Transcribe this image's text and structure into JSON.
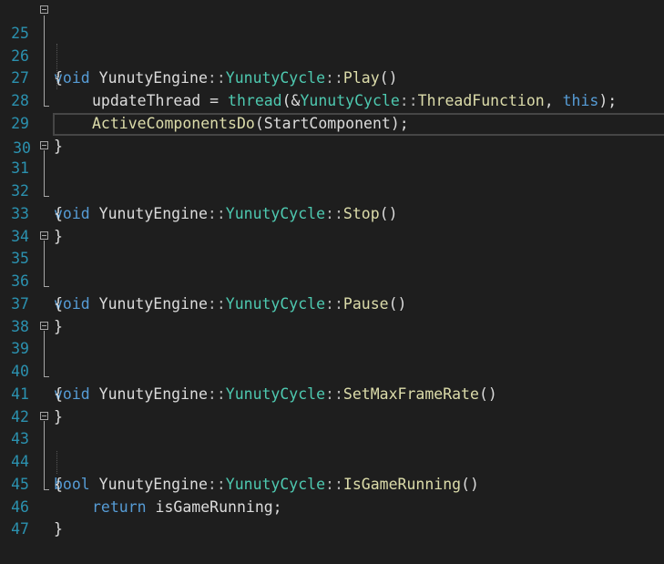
{
  "colors": {
    "background": "#1e1e1e",
    "line_number": "#2b91af",
    "keyword": "#569cd6",
    "type": "#4ec9b0",
    "function": "#dcdcaa",
    "plain": "#dcdcdc",
    "current_line_border": "#464646"
  },
  "lines": [
    {
      "num": "25",
      "tokens": [
        "void",
        " YunutyEngine",
        "::",
        "YunutyCycle",
        "::",
        "Play",
        "()"
      ]
    },
    {
      "num": "26",
      "tokens": [
        "{"
      ]
    },
    {
      "num": "27",
      "tokens": [
        "updateThread = ",
        "thread",
        "(&",
        "YunutyCycle",
        "::",
        "ThreadFunction",
        ", ",
        "this",
        ");"
      ]
    },
    {
      "num": "28",
      "tokens": [
        "ActiveComponentsDo",
        "(StartComponent);"
      ]
    },
    {
      "num": "29",
      "tokens": [
        "}"
      ]
    },
    {
      "num": "30",
      "tokens": []
    },
    {
      "num": "31",
      "tokens": [
        "void",
        " YunutyEngine",
        "::",
        "YunutyCycle",
        "::",
        "Stop",
        "()"
      ]
    },
    {
      "num": "32",
      "tokens": [
        "{"
      ]
    },
    {
      "num": "33",
      "tokens": [
        "}"
      ]
    },
    {
      "num": "34",
      "tokens": []
    },
    {
      "num": "35",
      "tokens": [
        "void",
        " YunutyEngine",
        "::",
        "YunutyCycle",
        "::",
        "Pause",
        "()"
      ]
    },
    {
      "num": "36",
      "tokens": [
        "{"
      ]
    },
    {
      "num": "37",
      "tokens": [
        "}"
      ]
    },
    {
      "num": "38",
      "tokens": []
    },
    {
      "num": "39",
      "tokens": [
        "void",
        " YunutyEngine",
        "::",
        "YunutyCycle",
        "::",
        "SetMaxFrameRate",
        "()"
      ]
    },
    {
      "num": "40",
      "tokens": [
        "{"
      ]
    },
    {
      "num": "41",
      "tokens": [
        "}"
      ]
    },
    {
      "num": "42",
      "tokens": []
    },
    {
      "num": "43",
      "tokens": [
        "bool",
        " YunutyEngine",
        "::",
        "YunutyCycle",
        "::",
        "IsGameRunning",
        "()"
      ]
    },
    {
      "num": "44",
      "tokens": [
        "{"
      ]
    },
    {
      "num": "45",
      "tokens": [
        "return",
        " isGameRunning;"
      ]
    },
    {
      "num": "46",
      "tokens": [
        "}"
      ]
    },
    {
      "num": "47",
      "tokens": []
    }
  ]
}
